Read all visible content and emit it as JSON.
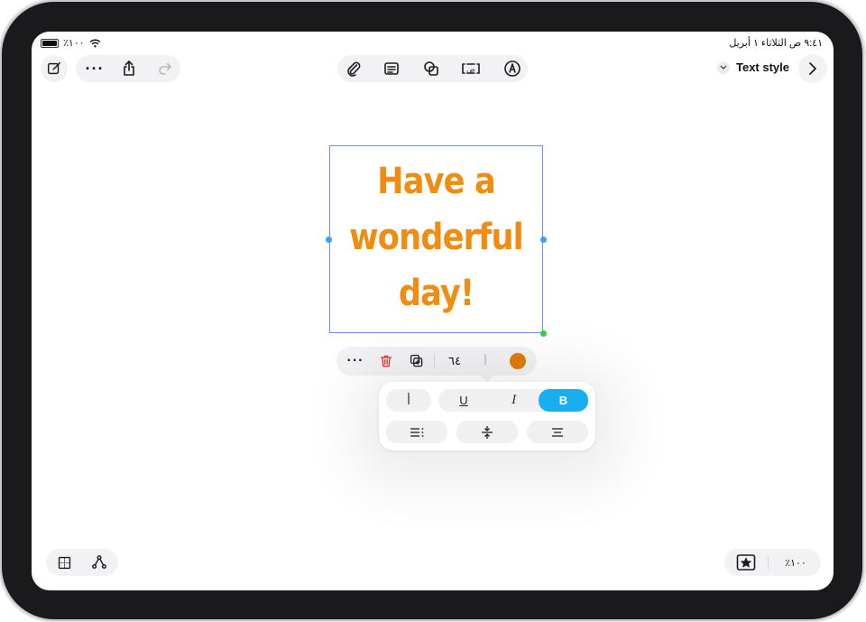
{
  "status_bar": {
    "time_date": "٩:٤١ ص  الثلاثاء ١ أبريل",
    "battery": "٪١٠٠"
  },
  "toolbar": {
    "text_style_label": "Text style"
  },
  "canvas": {
    "text_lines": [
      "Have a",
      "wonderful",
      "day!"
    ],
    "text_color": "#f08c12"
  },
  "context_menu": {
    "font_size": "٦٤",
    "font_glyph": "أ",
    "swatch_color": "#e07b0d"
  },
  "format_popover": {
    "font_glyph": "أ",
    "underline": "U",
    "italic": "I",
    "bold": "B",
    "bold_active": true
  },
  "bottom_bar": {
    "zoom": "٪١٠٠"
  },
  "colors": {
    "accent": "#19aef0",
    "selection": "#6f8fe6",
    "delete": "#e0302a"
  }
}
